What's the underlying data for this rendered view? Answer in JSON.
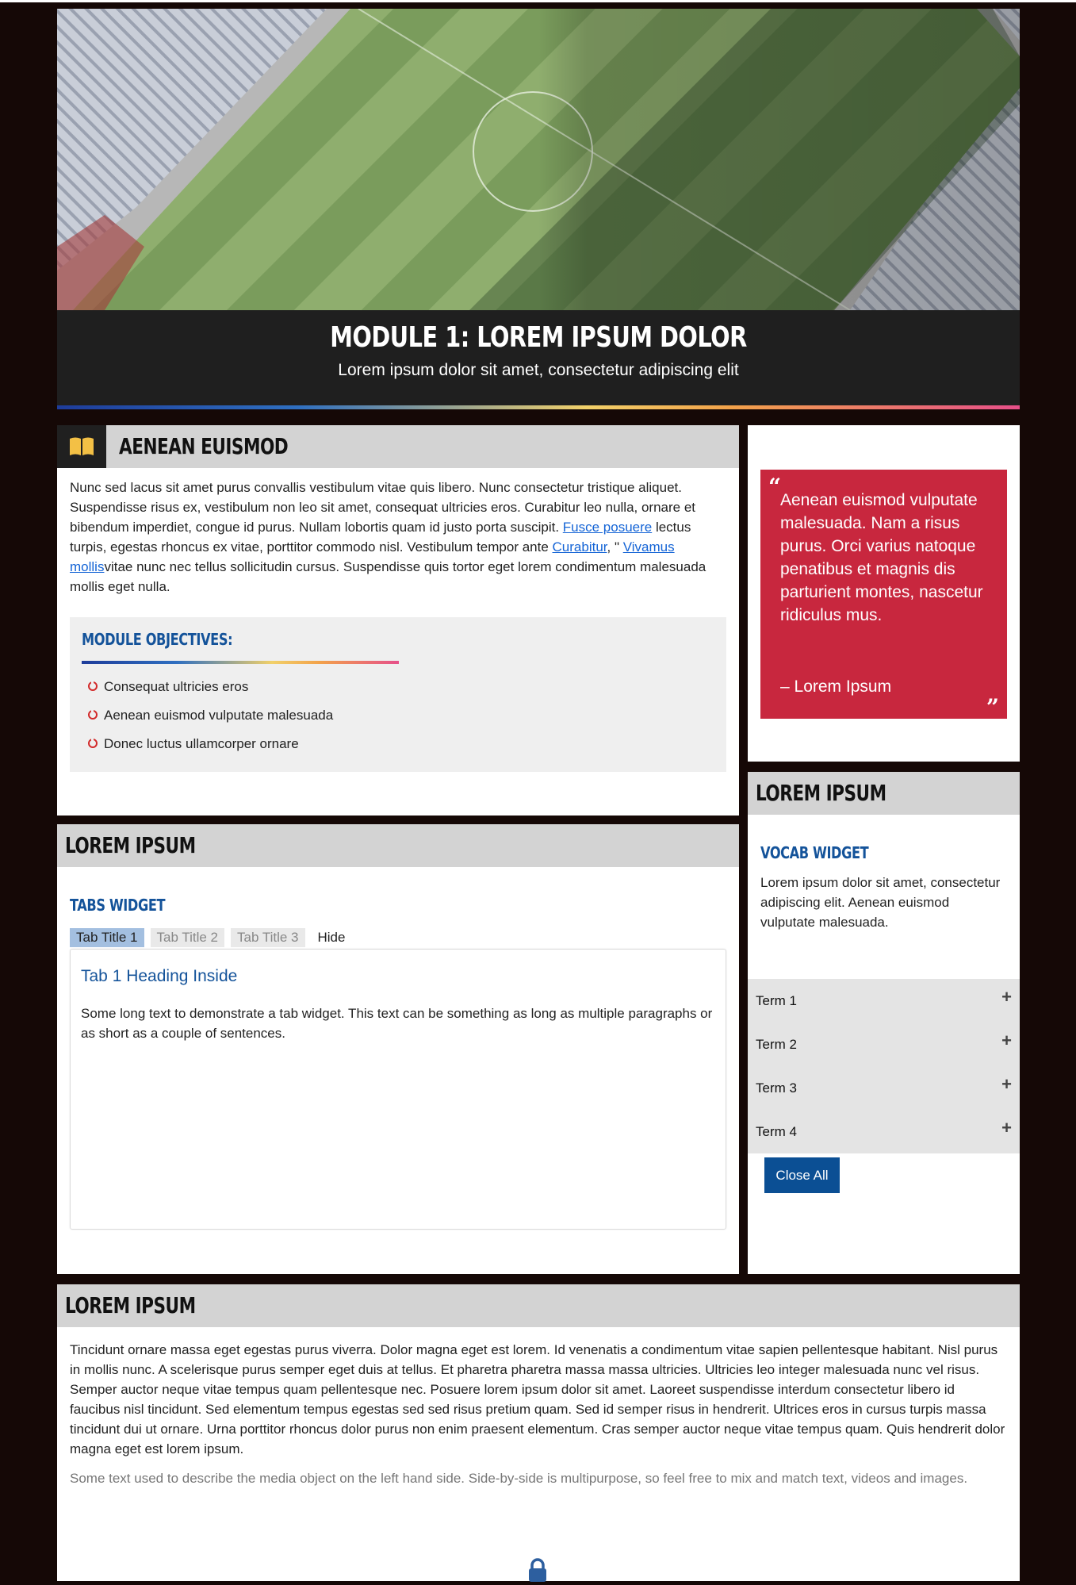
{
  "hero": {
    "title": "MODULE 1: LOREM IPSUM DOLOR",
    "subtitle": "Lorem ipsum dolor sit amet, consectetur adipiscing elit"
  },
  "intro_card": {
    "heading": "AENEAN EUISMOD",
    "icon": "book-open-icon",
    "p_part1": "Nunc sed lacus sit amet purus convallis vestibulum vitae quis libero. Nunc consectetur tristique aliquet. Suspendisse risus ex, vestibulum non leo sit amet, consequat ultricies eros. Curabitur leo nulla, ornare et bibendum imperdiet, congue id purus. Nullam lobortis quam id justo porta suscipit. ",
    "link1": "Fusce posuere",
    "p_part2": " lectus turpis, egestas rhoncus ex vitae, porttitor commodo nisl. Vestibulum tempor ante ",
    "link2": "Curabitur",
    "p_part3": ", \" ",
    "link3": "Vivamus mollis",
    "p_part4": "vitae nunc nec tellus sollicitudin cursus. Suspendisse quis tortor eget lorem condimentum malesuada mollis eget nulla.",
    "objectives_title": "MODULE OBJECTIVES:",
    "objectives": [
      "Consequat ultricies eros",
      "Aenean euismod vulputate malesuada",
      "Donec luctus ullamcorper ornare"
    ]
  },
  "quote": {
    "text": "Aenean euismod vulputate malesuada. Nam a risus purus. Orci varius natoque penatibus et magnis dis parturient montes, nascetur ridiculus mus.",
    "author": "– Lorem Ipsum",
    "open_mark": "“",
    "close_mark": "”"
  },
  "tabs_card": {
    "heading": "LOREM IPSUM",
    "widget_title": "TABS WIDGET",
    "tabs": [
      "Tab Title 1",
      "Tab Title 2",
      "Tab Title 3"
    ],
    "hide_label": "Hide",
    "panel_heading": "Tab 1 Heading Inside",
    "panel_text": "Some long text to demonstrate a tab widget. This text can be something as long as multiple paragraphs or as short as a couple of sentences."
  },
  "vocab_card": {
    "heading": "LOREM IPSUM",
    "widget_title": "VOCAB WIDGET",
    "text": "Lorem ipsum dolor sit amet, consectetur adipiscing elit. Aenean euismod vulputate malesuada.",
    "terms": [
      "Term 1",
      "Term 2",
      "Term 3",
      "Term 4"
    ],
    "close_all": "Close All"
  },
  "bottom_card": {
    "heading": "LOREM IPSUM",
    "text": "Tincidunt ornare massa eget egestas purus viverra. Dolor magna eget est lorem. Id venenatis a condimentum vitae sapien pellentesque habitant. Nisl purus in mollis nunc. A scelerisque purus semper eget duis at tellus. Et pharetra pharetra massa massa ultricies. Ultricies leo integer malesuada nunc vel risus. Semper auctor neque vitae tempus quam pellentesque nec. Posuere lorem ipsum dolor sit amet. Laoreet suspendisse interdum consectetur libero id faucibus nisl tincidunt. Sed elementum tempus egestas sed sed risus pretium quam. Sed id semper risus in hendrerit. Ultrices eros in cursus turpis massa tincidunt dui ut ornare. Urna porttitor rhoncus dolor purus non enim praesent elementum. Cras semper auctor neque vitae tempus quam. Quis hendrerit dolor magna eget est lorem ipsum.",
    "media_text": "Some text used to describe the media object on the left hand side. Side-by-side is multipurpose, so feel free to mix and match text, videos and images."
  },
  "colors": {
    "page_bg": "#150806",
    "quote_bg": "#c8273e",
    "accent_blue": "#14539a",
    "button_blue": "#0b4f94",
    "card_header": "#d3d3d3"
  }
}
